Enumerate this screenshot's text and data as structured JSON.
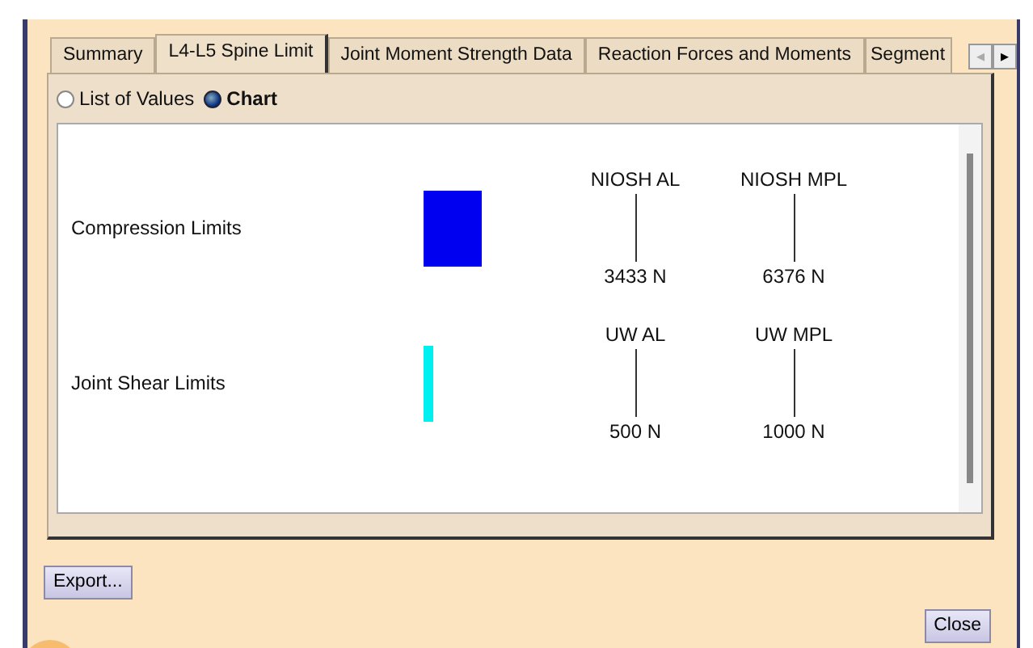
{
  "tabs": [
    {
      "label": "Summary",
      "selected": false
    },
    {
      "label": "L4-L5 Spine Limit",
      "selected": true
    },
    {
      "label": "Joint Moment Strength Data",
      "selected": false
    },
    {
      "label": "Reaction Forces and Moments",
      "selected": false
    },
    {
      "label": "Segment",
      "selected": false
    }
  ],
  "tab_scroll": [
    {
      "label": "◂",
      "disabled": true
    },
    {
      "label": "▸",
      "disabled": false
    }
  ],
  "view_options": [
    {
      "label": "List of Values",
      "selected": false
    },
    {
      "label": "Chart",
      "selected": true
    }
  ],
  "chart_rows": [
    {
      "label": "Compression Limits",
      "color": "#0000f0",
      "kind": "wide",
      "markers": [
        {
          "name": "NIOSH AL",
          "value": "3433 N"
        },
        {
          "name": "NIOSH MPL",
          "value": "6376 N"
        }
      ]
    },
    {
      "label": "Joint Shear Limits",
      "color": "#00f0f0",
      "kind": "narrow",
      "markers": [
        {
          "name": "UW AL",
          "value": "500 N"
        },
        {
          "name": "UW MPL",
          "value": "1000 N"
        }
      ]
    }
  ],
  "buttons": [
    {
      "label": "Export...",
      "kind": "export"
    },
    {
      "label": "Close",
      "kind": "close"
    }
  ]
}
